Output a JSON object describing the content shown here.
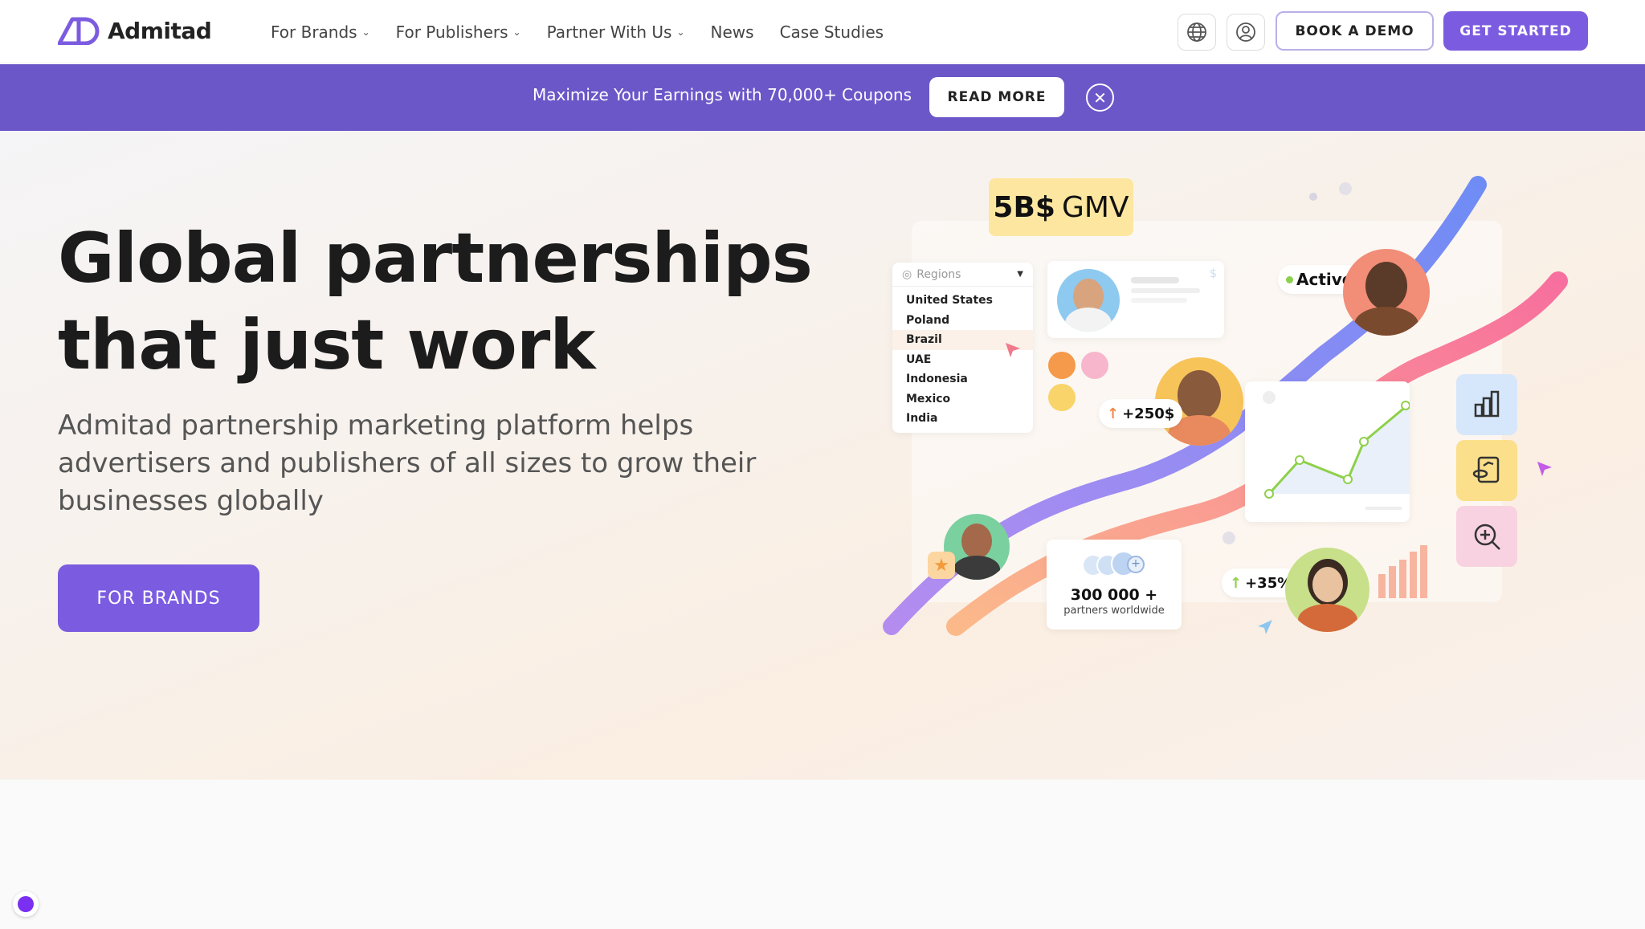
{
  "nav": {
    "logo_text": "Admitad",
    "menu": [
      {
        "label": "For Brands",
        "has_dropdown": true
      },
      {
        "label": "For Publishers",
        "has_dropdown": true
      },
      {
        "label": "Partner With Us",
        "has_dropdown": true
      },
      {
        "label": "News",
        "has_dropdown": false
      },
      {
        "label": "Case Studies",
        "has_dropdown": false
      }
    ],
    "globe_icon": "globe-icon",
    "user_icon": "user-icon",
    "book_demo_label": "BOOK A DEMO",
    "get_started_label": "GET STARTED"
  },
  "banner": {
    "text": "Maximize Your Earnings with 70,000+ Coupons",
    "read_more_label": "READ MORE",
    "close_icon": "close-icon"
  },
  "hero": {
    "title_line1": "Global partnerships",
    "title_line2": "that just work",
    "subtitle": "Admitad partnership marketing platform helps advertisers and publishers of all sizes to grow their businesses globally",
    "cta_label": "FOR BRANDS"
  },
  "illustration": {
    "gmv_bold": "5B$",
    "gmv_text": "GMV",
    "regions_label": "Regions",
    "regions": [
      "United States",
      "Poland",
      "Brazil",
      "UAE",
      "Indonesia",
      "Mexico",
      "India"
    ],
    "selected_region": "Brazil",
    "active_label": "Active",
    "earnings_badge": "+250$",
    "growth_badge": "+35%",
    "partners_count": "300 000 +",
    "partners_caption": "partners worldwide",
    "currency_symbol": "$"
  },
  "colors": {
    "accent": "#7b5ce0",
    "banner": "#6b57c8",
    "active_dot": "#8bd14c"
  }
}
